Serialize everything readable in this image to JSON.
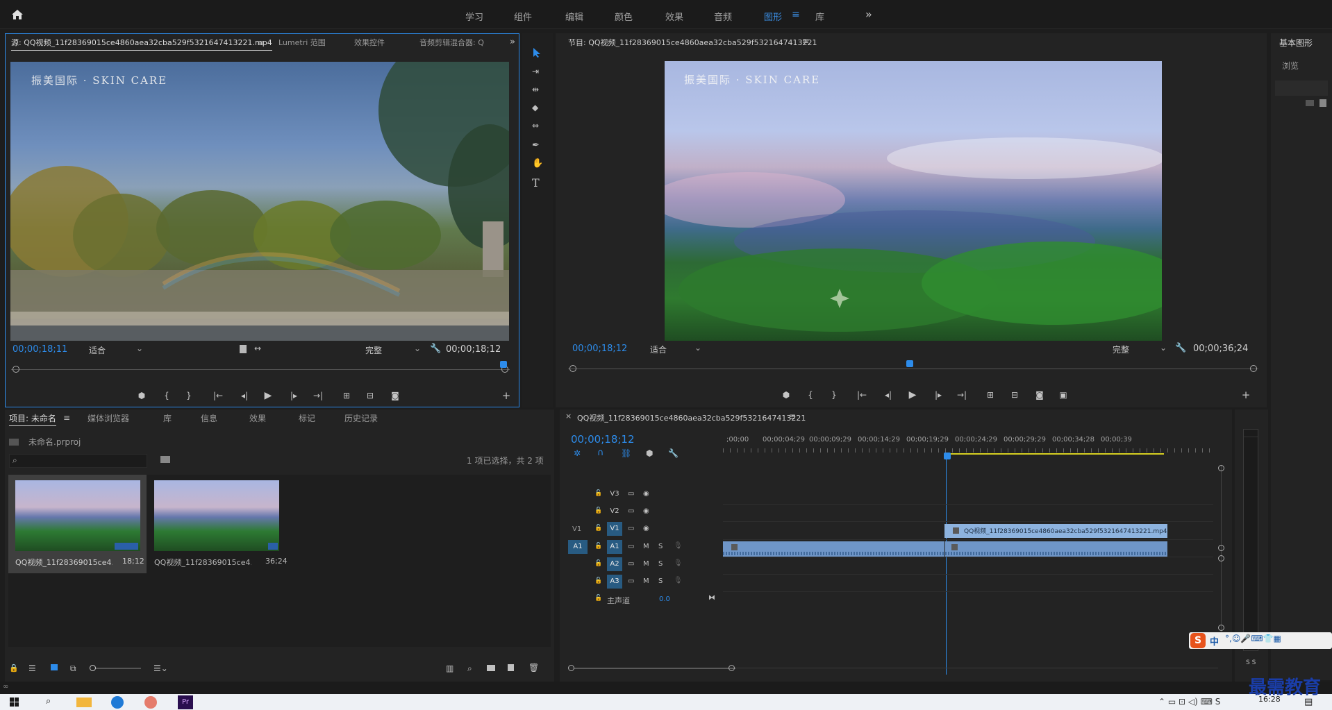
{
  "workspace": {
    "tabs": [
      {
        "label": "学习",
        "active": false
      },
      {
        "label": "组件",
        "active": false
      },
      {
        "label": "编辑",
        "active": false
      },
      {
        "label": "颜色",
        "active": false
      },
      {
        "label": "效果",
        "active": false
      },
      {
        "label": "音频",
        "active": false
      },
      {
        "label": "图形",
        "active": true
      },
      {
        "label": "库",
        "active": false
      }
    ],
    "more_label": "»"
  },
  "source_monitor": {
    "tabs": [
      "源: QQ视频_11f28369015ce4860aea32cba529f5321647413221.mp4",
      "Lumetri 范围",
      "效果控件",
      "音频剪辑混合器: Q"
    ],
    "overlay_text": "振美国际 · SKIN CARE",
    "timecode_current": "00;00;18;11",
    "fit_label": "适合",
    "quality_label": "完整",
    "timecode_duration": "00;00;18;12",
    "playhead_ratio": 1.0
  },
  "program_monitor": {
    "title": "节目: QQ视频_11f28369015ce4860aea32cba529f5321647413221",
    "overlay_text": "振美国际 · SKIN CARE",
    "timecode_current": "00;00;18;12",
    "fit_label": "适合",
    "quality_label": "完整",
    "timecode_duration": "00;00;36;24",
    "playhead_ratio": 0.5
  },
  "essential_graphics": {
    "title": "基本图形",
    "browse_label": "浏览"
  },
  "project_panel": {
    "tabs": [
      "项目: 未命名",
      "媒体浏览器",
      "库",
      "信息",
      "效果",
      "标记",
      "历史记录"
    ],
    "project_file": "未命名.prproj",
    "search_placeholder": "",
    "selection_status": "1 项已选择，共 2 项",
    "items": [
      {
        "name": "QQ视频_11f28369015ce4...",
        "duration": "18;12",
        "selected": true
      },
      {
        "name": "QQ视频_11f28369015ce4...",
        "duration": "36;24",
        "selected": false
      }
    ]
  },
  "timeline": {
    "sequence_name": "QQ视频_11f28369015ce4860aea32cba529f5321647413221",
    "timecode": "00;00;18;12",
    "ruler": [
      ";00;00",
      "00;00;04;29",
      "00;00;09;29",
      "00;00;14;29",
      "00;00;19;29",
      "00;00;24;29",
      "00;00;29;29",
      "00;00;34;28",
      "00;00;39"
    ],
    "tracks": [
      {
        "id": "V3",
        "kind": "video"
      },
      {
        "id": "V2",
        "kind": "video"
      },
      {
        "id": "V1",
        "kind": "video",
        "source": "V1"
      },
      {
        "id": "A1",
        "kind": "audio",
        "source": "A1"
      },
      {
        "id": "A2",
        "kind": "audio"
      },
      {
        "id": "A3",
        "kind": "audio"
      }
    ],
    "mute_label": "M",
    "solo_label": "S",
    "master_label": "主声道",
    "master_value": "0.0",
    "video_clip_label": "QQ视频_11f28369015ce4860aea32cba529f5321647413221.mp4 [V]"
  },
  "audio_meter": {
    "solo_labels": "S S"
  },
  "ime_toolbar": {
    "label": "中"
  },
  "taskbar": {
    "time": "16:28",
    "watermark": "最需教育"
  }
}
